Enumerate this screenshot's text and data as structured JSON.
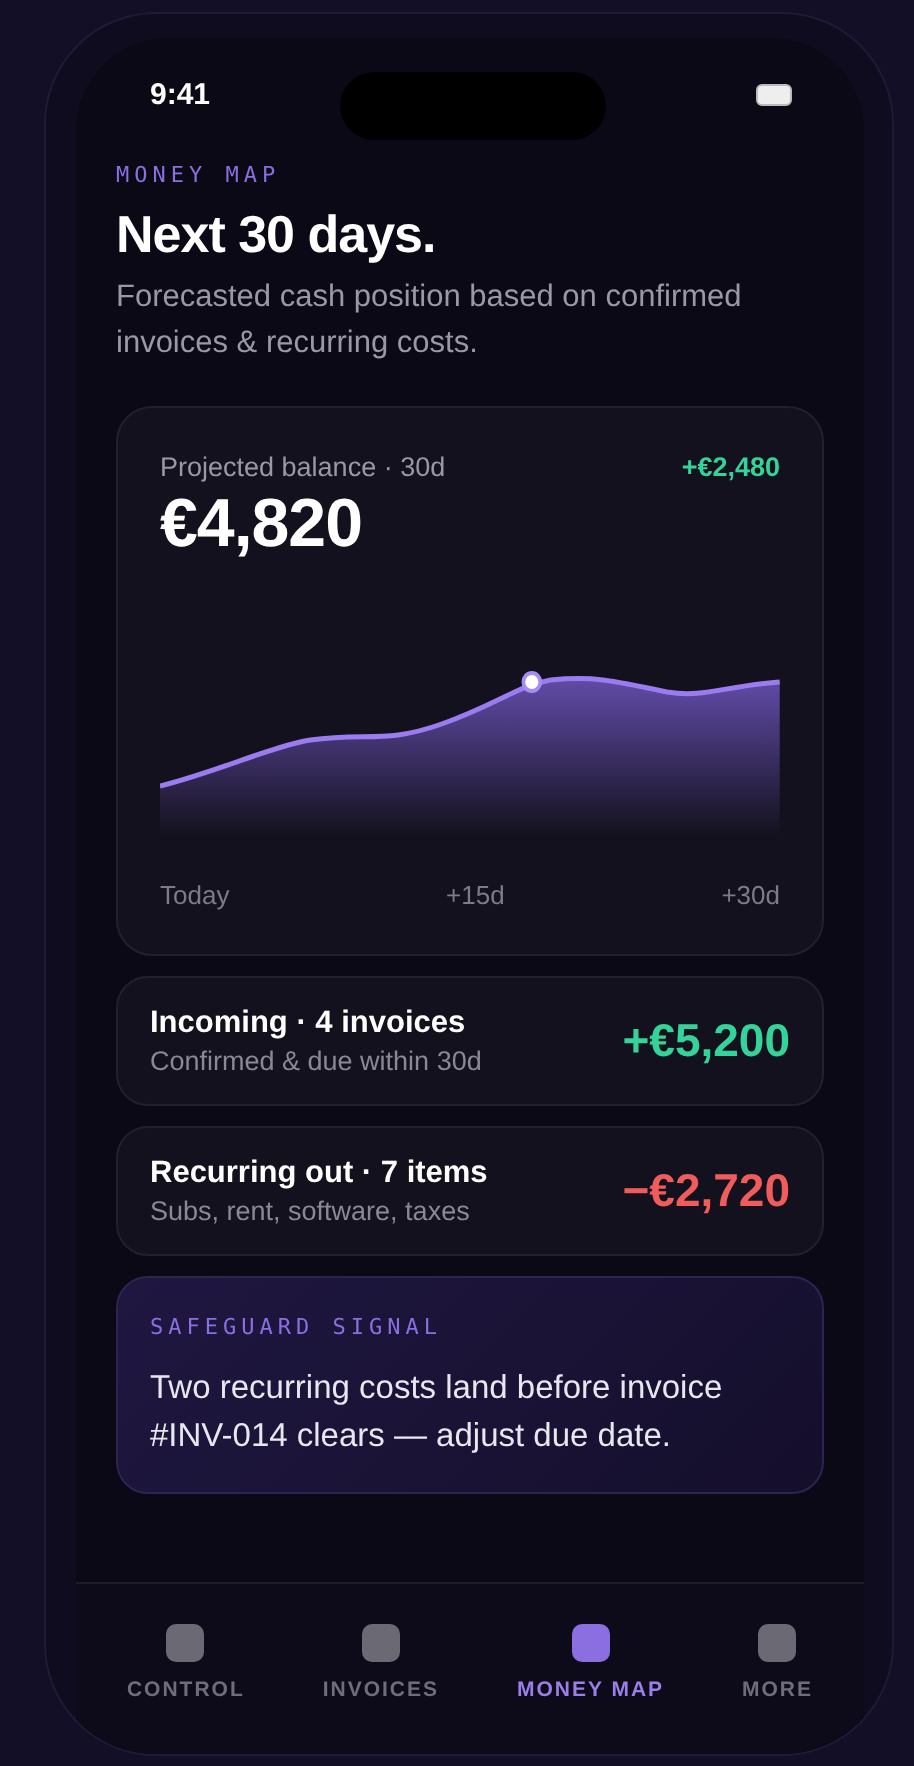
{
  "status_bar": {
    "time": "9:41"
  },
  "header": {
    "eyebrow": "MONEY MAP",
    "title": "Next 30 days.",
    "subtitle": "Forecasted cash position based on confirmed invoices & recurring costs."
  },
  "balance_card": {
    "label": "Projected balance · 30d",
    "change": "+€2,480",
    "amount": "€4,820",
    "axis_labels": [
      "Today",
      "+15d",
      "+30d"
    ]
  },
  "summary_rows": [
    {
      "title": "Incoming · 4 invoices",
      "subtitle": "Confirmed & due within 30d",
      "amount": "+€5,200",
      "kind": "positive"
    },
    {
      "title": "Recurring out · 7 items",
      "subtitle": "Subs, rent, software, taxes",
      "amount": "−€2,720",
      "kind": "negative"
    }
  ],
  "signal": {
    "eyebrow": "SAFEGUARD SIGNAL",
    "message": "Two recurring costs land before invoice #INV-014 clears — adjust due date."
  },
  "tab_bar": [
    {
      "label": "CONTROL",
      "selected": false
    },
    {
      "label": "INVOICES",
      "selected": false
    },
    {
      "label": "MONEY MAP",
      "selected": true
    },
    {
      "label": "MORE",
      "selected": false
    }
  ]
}
